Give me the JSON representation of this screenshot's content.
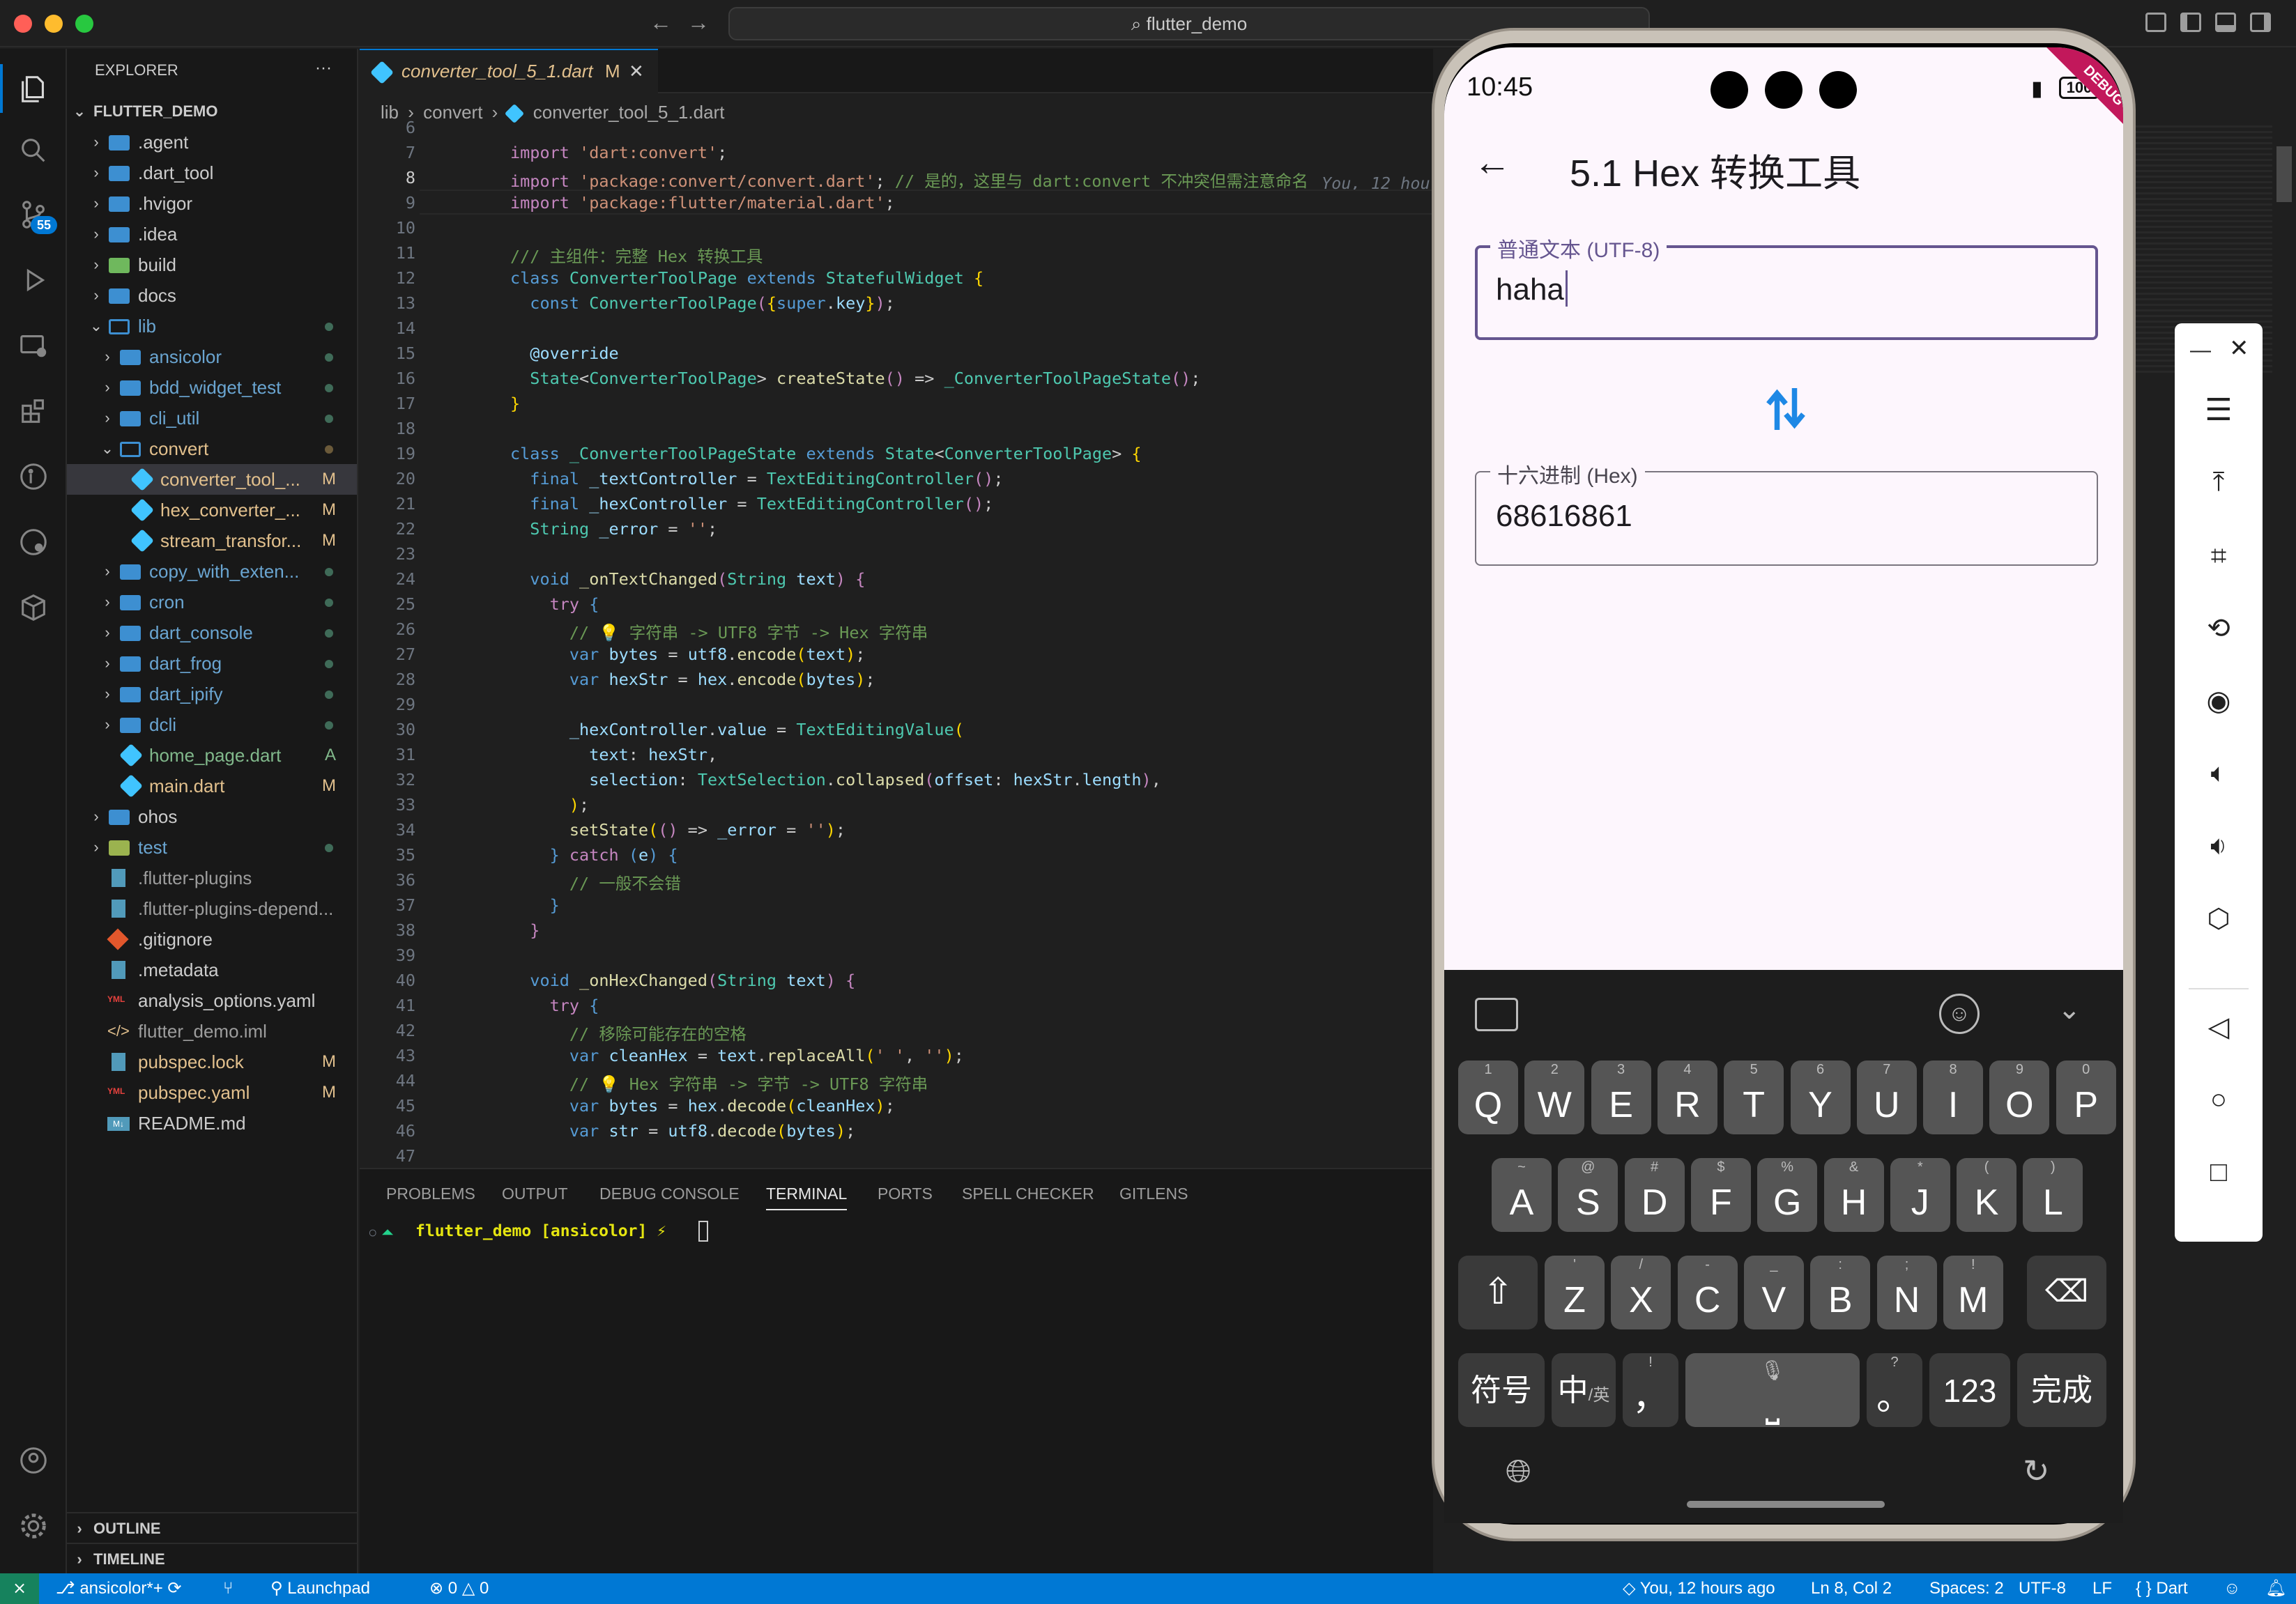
{
  "window": {
    "search_text": "flutter_demo"
  },
  "sidebar": {
    "title": "EXPLORER",
    "more": "···",
    "root": "FLUTTER_DEMO",
    "items": [
      {
        "label": ".agent"
      },
      {
        "label": ".dart_tool"
      },
      {
        "label": ".hvigor"
      },
      {
        "label": ".idea"
      },
      {
        "label": "build"
      },
      {
        "label": "docs"
      },
      {
        "label": "lib"
      },
      {
        "label": "ansicolor"
      },
      {
        "label": "bdd_widget_test"
      },
      {
        "label": "cli_util"
      },
      {
        "label": "convert"
      },
      {
        "label": "converter_tool_...",
        "badge": "M"
      },
      {
        "label": "hex_converter_...",
        "badge": "M"
      },
      {
        "label": "stream_transfor...",
        "badge": "M"
      },
      {
        "label": "copy_with_exten..."
      },
      {
        "label": "cron"
      },
      {
        "label": "dart_console"
      },
      {
        "label": "dart_frog"
      },
      {
        "label": "dart_ipify"
      },
      {
        "label": "dcli"
      },
      {
        "label": "home_page.dart",
        "badge": "A"
      },
      {
        "label": "main.dart",
        "badge": "M"
      },
      {
        "label": "ohos"
      },
      {
        "label": "test"
      },
      {
        "label": ".flutter-plugins"
      },
      {
        "label": ".flutter-plugins-depend..."
      },
      {
        "label": ".gitignore"
      },
      {
        "label": ".metadata"
      },
      {
        "label": "analysis_options.yaml"
      },
      {
        "label": "flutter_demo.iml"
      },
      {
        "label": "pubspec.lock",
        "badge": "M"
      },
      {
        "label": "pubspec.yaml",
        "badge": "M"
      },
      {
        "label": "README.md"
      }
    ],
    "outline": "OUTLINE",
    "timeline": "TIMELINE",
    "activity_badge": "55"
  },
  "editor": {
    "tab_label": "converter_tool_5_1.dart",
    "tab_badge": "M",
    "breadcrumb": [
      "lib",
      "convert",
      "converter_tool_5_1.dart"
    ],
    "blame": "You, 12 hou",
    "line_numbers": [
      "6",
      "7",
      "8",
      "9",
      "10",
      "11",
      "12",
      "13",
      "14",
      "15",
      "16",
      "17",
      "18",
      "19",
      "20",
      "21",
      "22",
      "23",
      "24",
      "25",
      "26",
      "27",
      "28",
      "29",
      "30",
      "31",
      "32",
      "33",
      "34",
      "35",
      "36",
      "37",
      "38",
      "39",
      "40",
      "41",
      "42",
      "43",
      "44",
      "45",
      "46",
      "47"
    ]
  },
  "panel": {
    "tabs": [
      "PROBLEMS",
      "OUTPUT",
      "DEBUG CONSOLE",
      "TERMINAL",
      "PORTS",
      "SPELL CHECKER",
      "GITLENS"
    ],
    "prompt": "flutter_demo [ansicolor] ⚡"
  },
  "statusbar": {
    "branch": "ansicolor*+",
    "launchpad": "Launchpad",
    "errors": "0",
    "warnings": "0",
    "blame": "You, 12 hours ago",
    "position": "Ln 8, Col 2",
    "spaces": "Spaces: 2",
    "encoding": "UTF-8",
    "eol": "LF",
    "language": "Dart"
  },
  "phone": {
    "time": "10:45",
    "battery": "100",
    "debug_banner": "DEBUG",
    "app_title": "5.1 Hex 转换工具",
    "text_field_label": "普通文本 (UTF-8)",
    "text_field_value": "haha",
    "hex_field_label": "十六进制 (Hex)",
    "hex_field_value": "68616861",
    "keyboard": {
      "row1": [
        [
          "Q",
          "1"
        ],
        [
          "W",
          "2"
        ],
        [
          "E",
          "3"
        ],
        [
          "R",
          "4"
        ],
        [
          "T",
          "5"
        ],
        [
          "Y",
          "6"
        ],
        [
          "U",
          "7"
        ],
        [
          "I",
          "8"
        ],
        [
          "O",
          "9"
        ],
        [
          "P",
          "0"
        ]
      ],
      "row2": [
        [
          "A",
          "~"
        ],
        [
          "S",
          "@"
        ],
        [
          "D",
          "#"
        ],
        [
          "F",
          "$"
        ],
        [
          "G",
          "%"
        ],
        [
          "H",
          "&"
        ],
        [
          "J",
          "*"
        ],
        [
          "K",
          "("
        ],
        [
          "L",
          ")"
        ]
      ],
      "row3": [
        [
          "Z",
          "'"
        ],
        [
          "X",
          "/"
        ],
        [
          "C",
          "-"
        ],
        [
          "V",
          "_"
        ],
        [
          "B",
          ":"
        ],
        [
          "N",
          ";"
        ],
        [
          "M",
          "!"
        ]
      ],
      "symbols": "符号",
      "lang_main": "中",
      "lang_sub": "/英",
      "comma": "，",
      "period": "。",
      "comma_sup": "!",
      "period_sup": "?",
      "numbers": "123",
      "done": "完成"
    }
  }
}
